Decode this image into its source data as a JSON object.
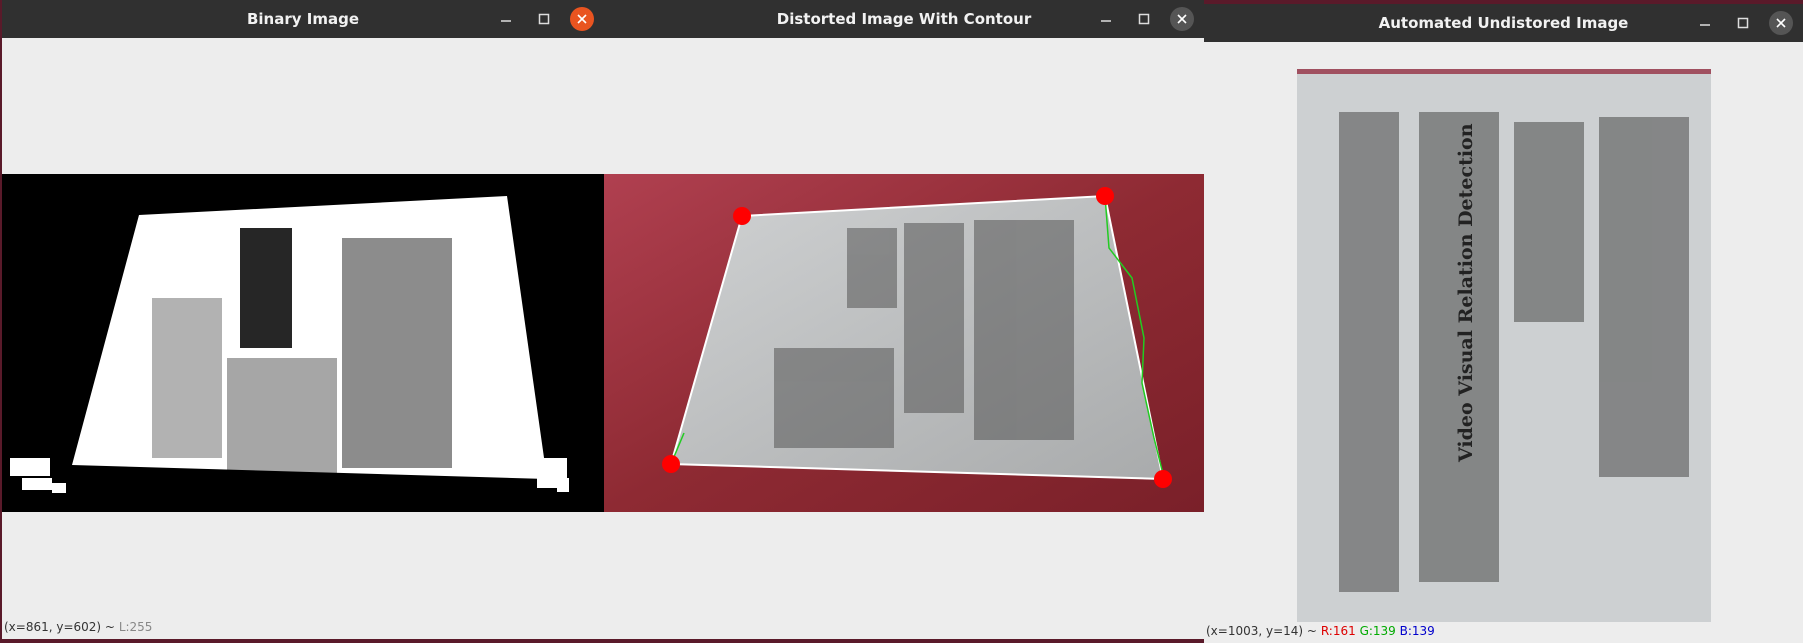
{
  "windows": [
    {
      "title": "Binary Image",
      "status": {
        "coords": "(x=861, y=602) ~",
        "value": "L:255"
      }
    },
    {
      "title": "Distorted Image With Contour"
    },
    {
      "title": "Automated Undistored Image",
      "status": {
        "coords": "(x=1003, y=14) ~",
        "r": "R:161",
        "g": "G:139",
        "b": "B:139"
      }
    }
  ],
  "document": {
    "title": "Video Visual Relation Detection"
  },
  "colors": {
    "titlebar": "#303030",
    "close_active": "#e95420",
    "contour": "#22cc22",
    "corner": "#ff0000",
    "red_background": "#8e2a33"
  },
  "icons": [
    "minimize-icon",
    "maximize-icon",
    "close-icon"
  ]
}
